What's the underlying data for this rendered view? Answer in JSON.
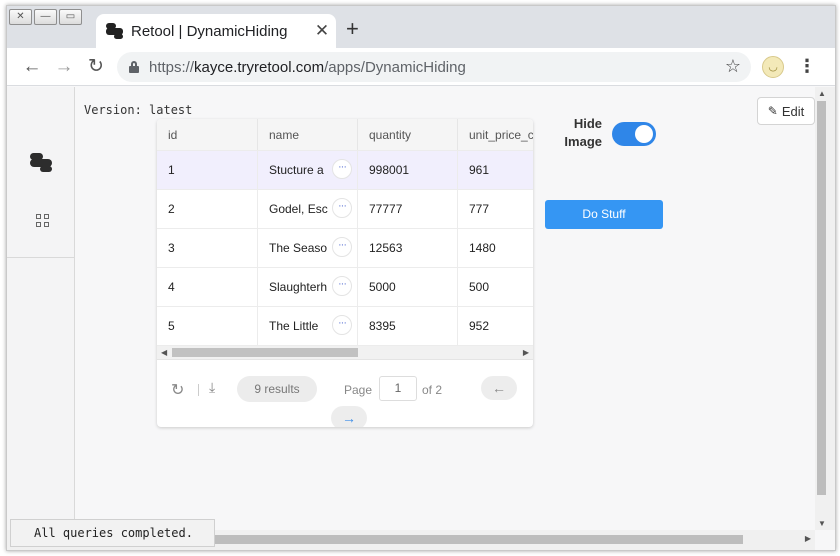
{
  "browser": {
    "window_buttons": [
      "✕",
      "—",
      "▭"
    ],
    "tab_title": "Retool | DynamicHiding",
    "tab_close": "✕",
    "new_tab": "+",
    "nav": {
      "back": "←",
      "forward": "→",
      "reload": "↻"
    },
    "url_scheme": "https://",
    "url_host": "kayce.tryretool.com",
    "url_path": "/apps/DynamicHiding",
    "bookmark_star": "☆",
    "menu": "⋮"
  },
  "app": {
    "version_label": "Version: latest",
    "edit_label": "Edit",
    "hide_image_label_line1": "Hide",
    "hide_image_label_line2": "Image",
    "hide_image_on": true,
    "do_stuff_label": "Do Stuff",
    "status_text": "All queries completed."
  },
  "table": {
    "columns": [
      "id",
      "name",
      "quantity",
      "unit_price_c"
    ],
    "rows": [
      {
        "id": "1",
        "name": "Stucture a",
        "quantity": "998001",
        "price": "961"
      },
      {
        "id": "2",
        "name": "Godel, Esc",
        "quantity": "77777",
        "price": "777"
      },
      {
        "id": "3",
        "name": "The Seaso",
        "quantity": "12563",
        "price": "1480"
      },
      {
        "id": "4",
        "name": "Slaughterh",
        "quantity": "5000",
        "price": "500"
      },
      {
        "id": "5",
        "name": "The Little",
        "quantity": "8395",
        "price": "952"
      }
    ],
    "more_glyph": "···",
    "results_label": "9 results",
    "page_label": "Page",
    "page_value": "1",
    "of_label": "of 2",
    "prev_glyph": "←",
    "next_glyph": "→"
  },
  "colors": {
    "accent": "#3596f3",
    "toggle_on": "#2f86e8",
    "selected_row": "#f1effd"
  }
}
